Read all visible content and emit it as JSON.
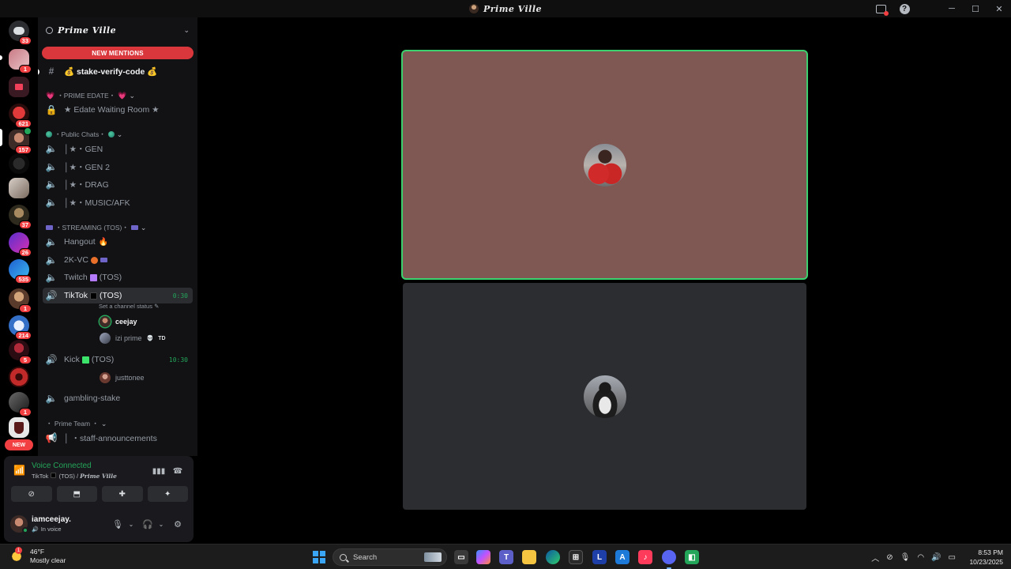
{
  "window": {
    "title": "Prime Ville"
  },
  "rail": {
    "items": [
      {
        "name": "home",
        "badge": "33"
      },
      {
        "name": "server-1",
        "badge": "1"
      },
      {
        "name": "folder",
        "badge": ""
      },
      {
        "name": "server-3",
        "badge": "621"
      },
      {
        "name": "server-4",
        "badge": "157"
      },
      {
        "name": "server-5",
        "badge": ""
      },
      {
        "name": "server-6",
        "badge": ""
      },
      {
        "name": "server-7",
        "badge": "37"
      },
      {
        "name": "server-8",
        "badge": "26"
      },
      {
        "name": "server-9",
        "badge": "535"
      },
      {
        "name": "server-10",
        "badge": "1"
      },
      {
        "name": "server-11",
        "badge": "214"
      },
      {
        "name": "server-12",
        "badge": "5"
      },
      {
        "name": "server-13",
        "badge": ""
      },
      {
        "name": "server-14",
        "badge": "1"
      },
      {
        "name": "server-15",
        "badge": ""
      }
    ],
    "new_label": "NEW"
  },
  "server": {
    "name": "Prime Ville",
    "new_mentions": "NEW MENTIONS"
  },
  "channels": {
    "stake_verify": "💰 stake-verify-code 💰",
    "cat_edate": "・PRIME EDATE・",
    "edate_room": "★ Edate Waiting Room ★",
    "cat_public": "・Public Chats・",
    "gen": "│★・GEN",
    "gen2": "│★・GEN 2",
    "drag": "│★・DRAG",
    "music": "│★・MUSIC/AFK",
    "cat_streaming": "・STREAMING (TOS)・",
    "hangout": "Hangout",
    "twok": "2K-VC",
    "twitch": "Twitch",
    "twitch_tos": "(TOS)",
    "tiktok": "TikTok",
    "tiktok_tos": "(TOS)",
    "tiktok_timer": "0:30",
    "tiktok_status": "Set a channel status",
    "member_ceejay": "ceejay",
    "member_izi": "izi prime",
    "member_izi_tag": "TD",
    "kick": "Kick",
    "kick_tos": "(TOS)",
    "kick_timer": "10:30",
    "member_justtonee": "justtonee",
    "gambling": "gambling-stake",
    "cat_team": "・ Prime Team ・",
    "staff": "│ ・staff-announcements"
  },
  "voice": {
    "status": "Voice Connected",
    "channel": "TikTok",
    "channel_suffix": "(TOS) /",
    "server": "Prime Ville"
  },
  "user": {
    "name": "iamceejay.",
    "status": "In voice"
  },
  "taskbar": {
    "temp": "46°F",
    "weather": "Mostly clear",
    "weather_badge": "1",
    "search": "Search",
    "time": "8:53 PM",
    "date": "10/23/2025"
  },
  "colors": {
    "accent_green": "#23a55a",
    "mention_red": "#da373c",
    "speaking_tile": "#7f5753",
    "idle_tile": "#2b2d31"
  }
}
